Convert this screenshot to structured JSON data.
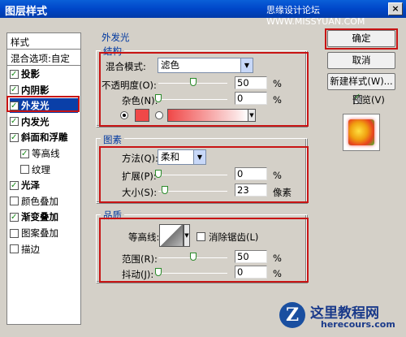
{
  "window": {
    "title": "图层样式",
    "watermark": "思缘设计论坛 WWW.MISSYUAN.COM",
    "close_label": "×"
  },
  "sidebar": {
    "header": "样式",
    "blend_options": "混合选项:自定",
    "items": [
      {
        "label": "投影",
        "checked": true,
        "bold": true
      },
      {
        "label": "内阴影",
        "checked": true,
        "bold": true
      },
      {
        "label": "外发光",
        "checked": true,
        "bold": true,
        "selected": true
      },
      {
        "label": "内发光",
        "checked": true,
        "bold": true
      },
      {
        "label": "斜面和浮雕",
        "checked": true,
        "bold": true
      },
      {
        "label": "等高线",
        "checked": true,
        "bold": false,
        "indent": true
      },
      {
        "label": "纹理",
        "checked": false,
        "bold": false,
        "indent": true
      },
      {
        "label": "光泽",
        "checked": true,
        "bold": true
      },
      {
        "label": "颜色叠加",
        "checked": false,
        "bold": false
      },
      {
        "label": "渐变叠加",
        "checked": true,
        "bold": true
      },
      {
        "label": "图案叠加",
        "checked": false,
        "bold": false
      },
      {
        "label": "描边",
        "checked": false,
        "bold": false
      }
    ]
  },
  "outer_glow": {
    "title": "外发光",
    "structure": {
      "title": "结构",
      "blend_mode_label": "混合模式:",
      "blend_mode_value": "滤色",
      "opacity_label": "不透明度(O):",
      "opacity_value": "50",
      "opacity_unit": "%",
      "opacity_fraction": 0.5,
      "noise_label": "杂色(N):",
      "noise_value": "0",
      "noise_unit": "%",
      "noise_fraction": 0,
      "swatch_color": "#f04848"
    },
    "elements": {
      "title": "图素",
      "method_label": "方法(Q):",
      "method_value": "柔和",
      "spread_label": "扩展(P):",
      "spread_value": "0",
      "spread_unit": "%",
      "spread_fraction": 0,
      "size_label": "大小(S):",
      "size_value": "23",
      "size_unit": "像素",
      "size_fraction": 0.092
    },
    "quality": {
      "title": "品质",
      "contour_label": "等高线:",
      "antialias_label": "消除锯齿(L)",
      "antialias_checked": false,
      "range_label": "范围(R):",
      "range_value": "50",
      "range_unit": "%",
      "range_fraction": 0.5,
      "jitter_label": "抖动(J):",
      "jitter_value": "0",
      "jitter_unit": "%",
      "jitter_fraction": 0
    }
  },
  "buttons": {
    "ok": "确定",
    "cancel": "取消",
    "new_style": "新建样式(W)...",
    "preview_label": "预览(V)",
    "preview_checked": true
  },
  "site": {
    "logo_letter": "Z",
    "name": "这里教程网",
    "url": "herecours.com"
  }
}
